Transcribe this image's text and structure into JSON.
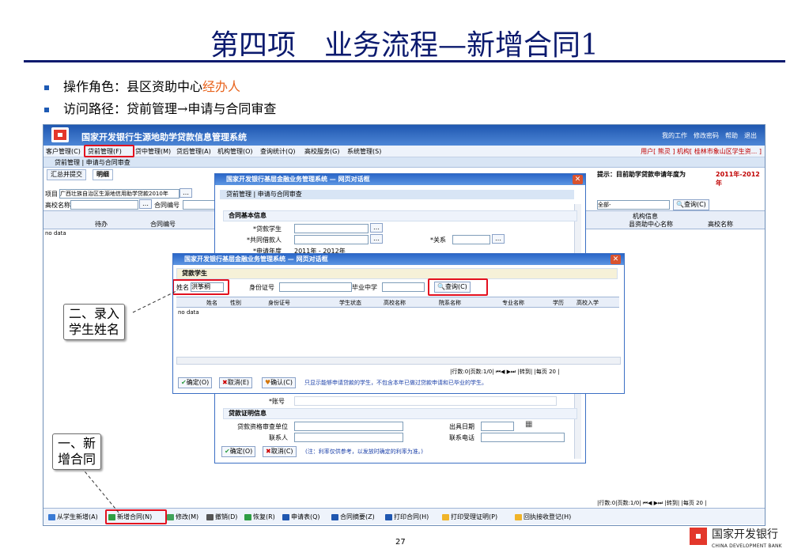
{
  "slide": {
    "title": "第四项　业务流程—新增合同1",
    "bullet1_prefix": "操作角色：县区资助中心",
    "bullet1_highlight": "经办人",
    "bullet2": "访问路径：贷前管理→申请与合同审查",
    "page_number": "27",
    "logo_cn": "国家开发银行",
    "logo_en": "CHINA DEVELOPMENT BANK"
  },
  "callouts": {
    "step1": "一、新\n增合同",
    "step2": "二、录入\n学生姓名"
  },
  "app": {
    "title": "国家开发银行生源地助学贷款信息管理系统",
    "top_links": "我的工作　修改密码　帮助　退出",
    "menu": [
      "客户管理(C)",
      "贷前管理(F)",
      "贷中管理(M)",
      "贷后管理(A)",
      "机构管理(O)",
      "查询统计(Q)",
      "高校服务(G)",
      "系统管理(S)"
    ],
    "user_info": "用户[ 熊灵 ]  机构[ 桂林市象山区学生资... ]",
    "breadcrumb": "贷前管理 | 申请与合同审查",
    "tabs": [
      "汇总并提交",
      "明细"
    ],
    "hint_label": "提示：目前助学贷款申请年度为",
    "hint_value": "2011年-2012年",
    "project_label": "项目",
    "project_value": "广西壮族自治区生源地信用助学贷款2010年",
    "school_label": "高校名称",
    "contract_no_label": "合同编号",
    "dept_select": "全部-",
    "query_btn": "查询(C)",
    "grid_headers": [
      "待办",
      "合同编号"
    ],
    "grid_headers_right": [
      "机构信息",
      "县资助中心名称",
      "高校名称"
    ],
    "no_data": "no data",
    "pager": "|行数:0|页数:1/0| ⏮◀ ▶⏭ |转到|  |每页 20 |",
    "bottom_buttons": [
      "从学生新增(A)",
      "新增合同(N)",
      "修改(M)",
      "撤销(D)",
      "恢复(R)",
      "申请表(Q)",
      "合同摘要(Z)",
      "打印合同(H)",
      "打印受理证明(P)",
      "回执接收登记(H)"
    ]
  },
  "dialog_back": {
    "title": "国家开发银行基层金融业务管理系统 — 网页对话框",
    "breadcrumb": "贷前管理 | 申请与合同审查",
    "section1": "合同基本信息",
    "f_student": "*贷款学生",
    "f_co_borrower": "*共同借款人",
    "f_relation": "*关系",
    "f_apply_year": "*申请年度",
    "apply_year_value": "2011年 - 2012年",
    "f_account": "*账号",
    "section2": "贷款证明信息",
    "f_audit_unit": "贷款资格审查单位",
    "f_issue_date": "出具日期",
    "f_contact": "联系人",
    "f_phone": "联系电话",
    "ok_btn": "确定(O)",
    "cancel_btn": "取消(C)",
    "note": "(注：利率仅供参考，以发放时确定的利率为准。)"
  },
  "dialog_front": {
    "title": "国家开发银行基层金融业务管理系统 — 网页对话框",
    "section": "贷款学生",
    "name_label": "姓名",
    "name_value": "洪筝桐",
    "id_label": "身份证号",
    "school_label": "毕业中学",
    "query_btn": "查询(C)",
    "columns": [
      "姓名",
      "性别",
      "身份证号",
      "学生状态",
      "高校名称",
      "院系名称",
      "专业名称",
      "学历",
      "高校入学"
    ],
    "no_data": "no data",
    "pager": "|行数:0|页数:1/0| ⏮◀ ▶⏭ |转到|  |每页 20 |",
    "ok_btn": "确定(O)",
    "cancel_btn": "取消(E)",
    "confirm_btn": "确认(C)",
    "note": "只显示能够申请贷款的学生，不包含本年已做过贷款申请和已毕业的学生。"
  },
  "colors": {
    "title": "#0b1a6e",
    "highlight": "#e8641e",
    "redbox": "#e3101f",
    "titlebar": "#1f57b0",
    "note": "#1a3fa8"
  }
}
